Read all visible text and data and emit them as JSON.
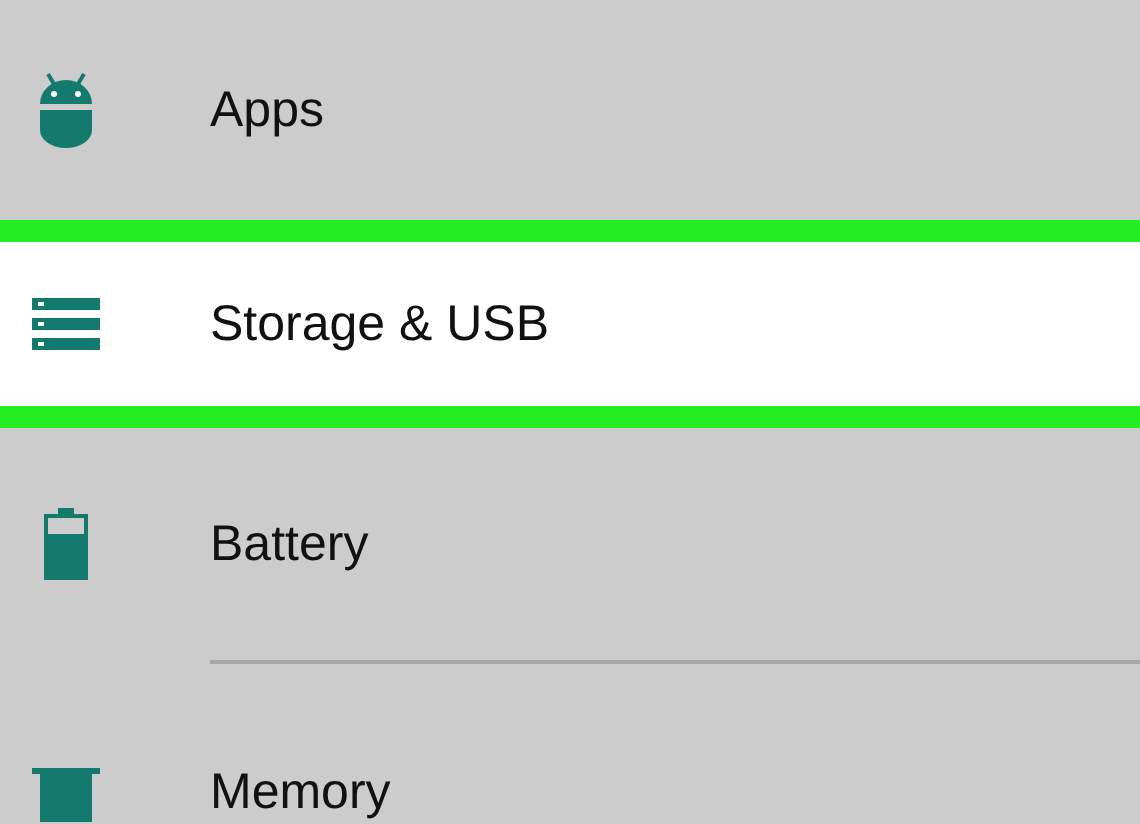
{
  "settings_items": [
    {
      "label": "Apps",
      "kind": "android",
      "selected": false,
      "divider": false
    },
    {
      "label": "Storage & USB",
      "kind": "storage",
      "selected": true,
      "divider": false
    },
    {
      "label": "Battery",
      "kind": "battery",
      "selected": false,
      "divider": true
    },
    {
      "label": "Memory",
      "kind": "chip",
      "selected": false,
      "divider": false
    }
  ]
}
